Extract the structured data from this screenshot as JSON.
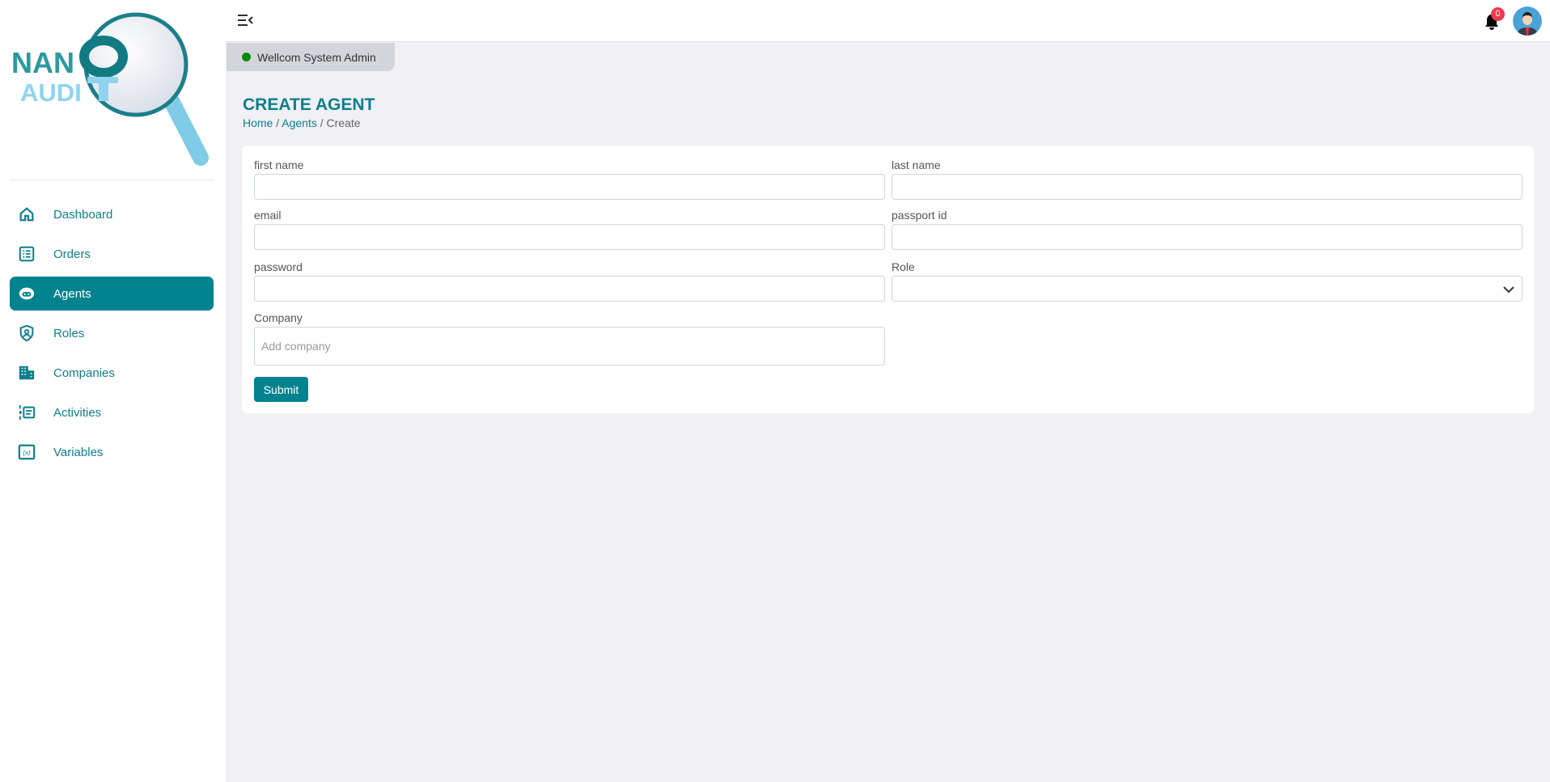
{
  "logo": {
    "line1": "NANO",
    "line2": "AUDIT"
  },
  "sidebar": {
    "items": [
      {
        "label": "Dashboard",
        "icon": "home-icon",
        "active": false
      },
      {
        "label": "Orders",
        "icon": "list-icon",
        "active": false
      },
      {
        "label": "Agents",
        "icon": "agent-icon",
        "active": true
      },
      {
        "label": "Roles",
        "icon": "shield-user-icon",
        "active": false
      },
      {
        "label": "Companies",
        "icon": "building-icon",
        "active": false
      },
      {
        "label": "Activities",
        "icon": "activity-icon",
        "active": false
      },
      {
        "label": "Variables",
        "icon": "variable-icon",
        "active": false
      }
    ]
  },
  "header": {
    "notification_count": "0"
  },
  "welcome": "Wellcom System Admin",
  "page": {
    "title": "CREATE AGENT",
    "breadcrumb": [
      "Home",
      "Agents",
      "Create"
    ]
  },
  "form": {
    "first_name": {
      "label": "first name",
      "value": ""
    },
    "last_name": {
      "label": "last name",
      "value": ""
    },
    "email": {
      "label": "email",
      "value": ""
    },
    "passport_id": {
      "label": "passport id",
      "value": ""
    },
    "password": {
      "label": "password",
      "value": ""
    },
    "role": {
      "label": "Role",
      "value": ""
    },
    "company": {
      "label": "Company",
      "placeholder": "Add company"
    },
    "submit": "Submit"
  },
  "colors": {
    "accent": "#00838f",
    "badge": "#f0384f",
    "status": "#0a8a0a"
  }
}
